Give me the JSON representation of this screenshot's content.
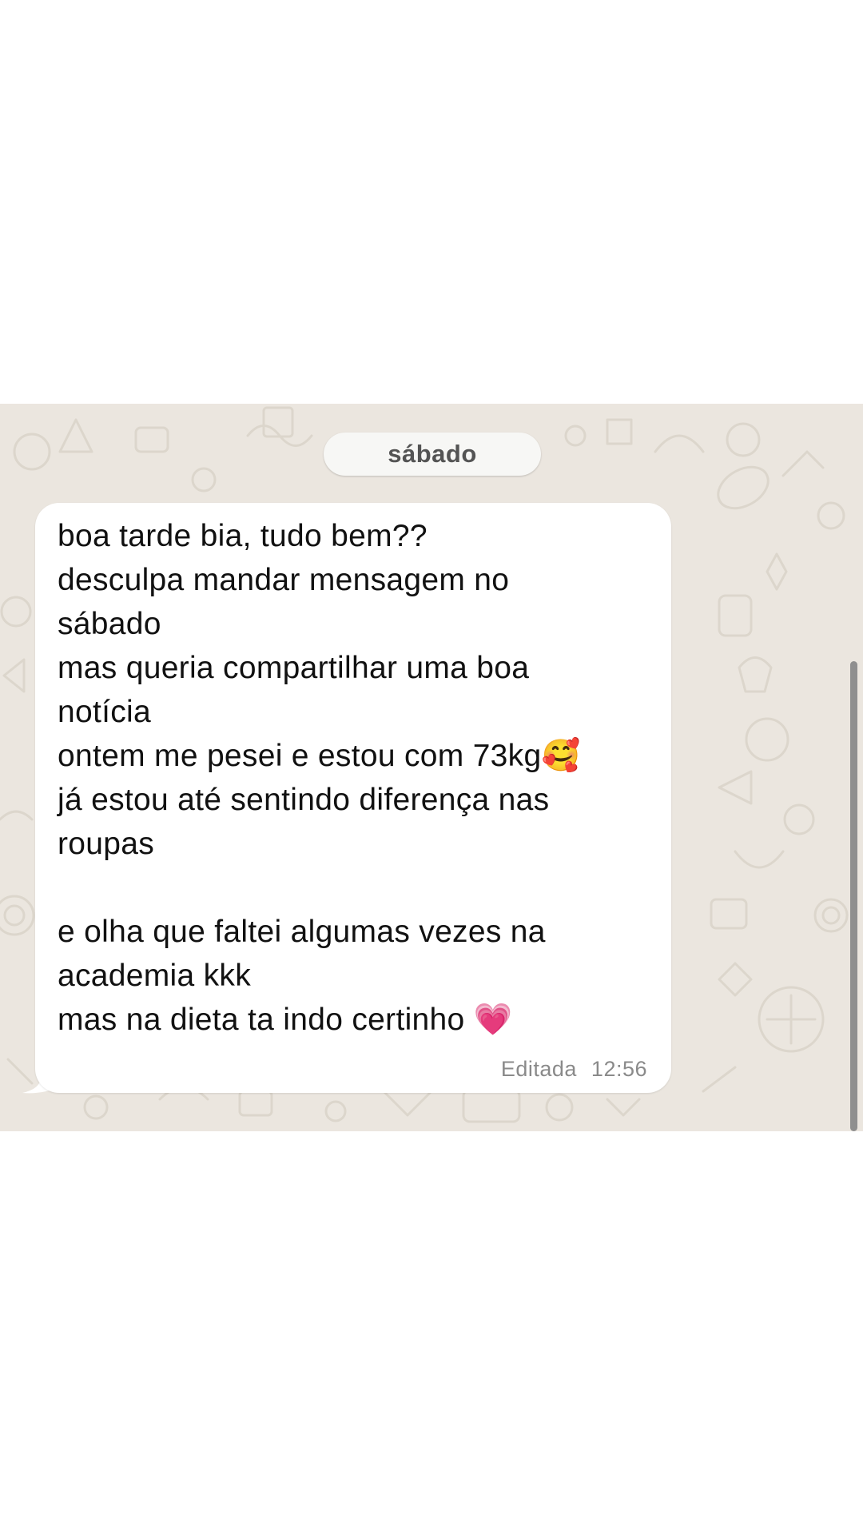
{
  "conversation": {
    "date_separator": "sábado",
    "message": {
      "lines": [
        "boa tarde bia, tudo bem??",
        "desculpa mandar mensagem no",
        "sábado",
        "mas queria compartilhar uma boa",
        "notícia",
        "ontem me pesei e estou com 73kg🥰",
        "já estou até sentindo diferença nas",
        "roupas",
        "",
        "e olha que faltei algumas vezes na",
        "academia kkk",
        "mas na dieta ta indo certinho 💗"
      ],
      "edited_label": "Editada",
      "time": "12:56"
    }
  },
  "colors": {
    "page_background": "#ffffff",
    "chat_wallpaper": "#ebe6df",
    "bubble": "#ffffff",
    "date_pill": "#f7f7f5",
    "meta_text": "#8a8a8a"
  }
}
